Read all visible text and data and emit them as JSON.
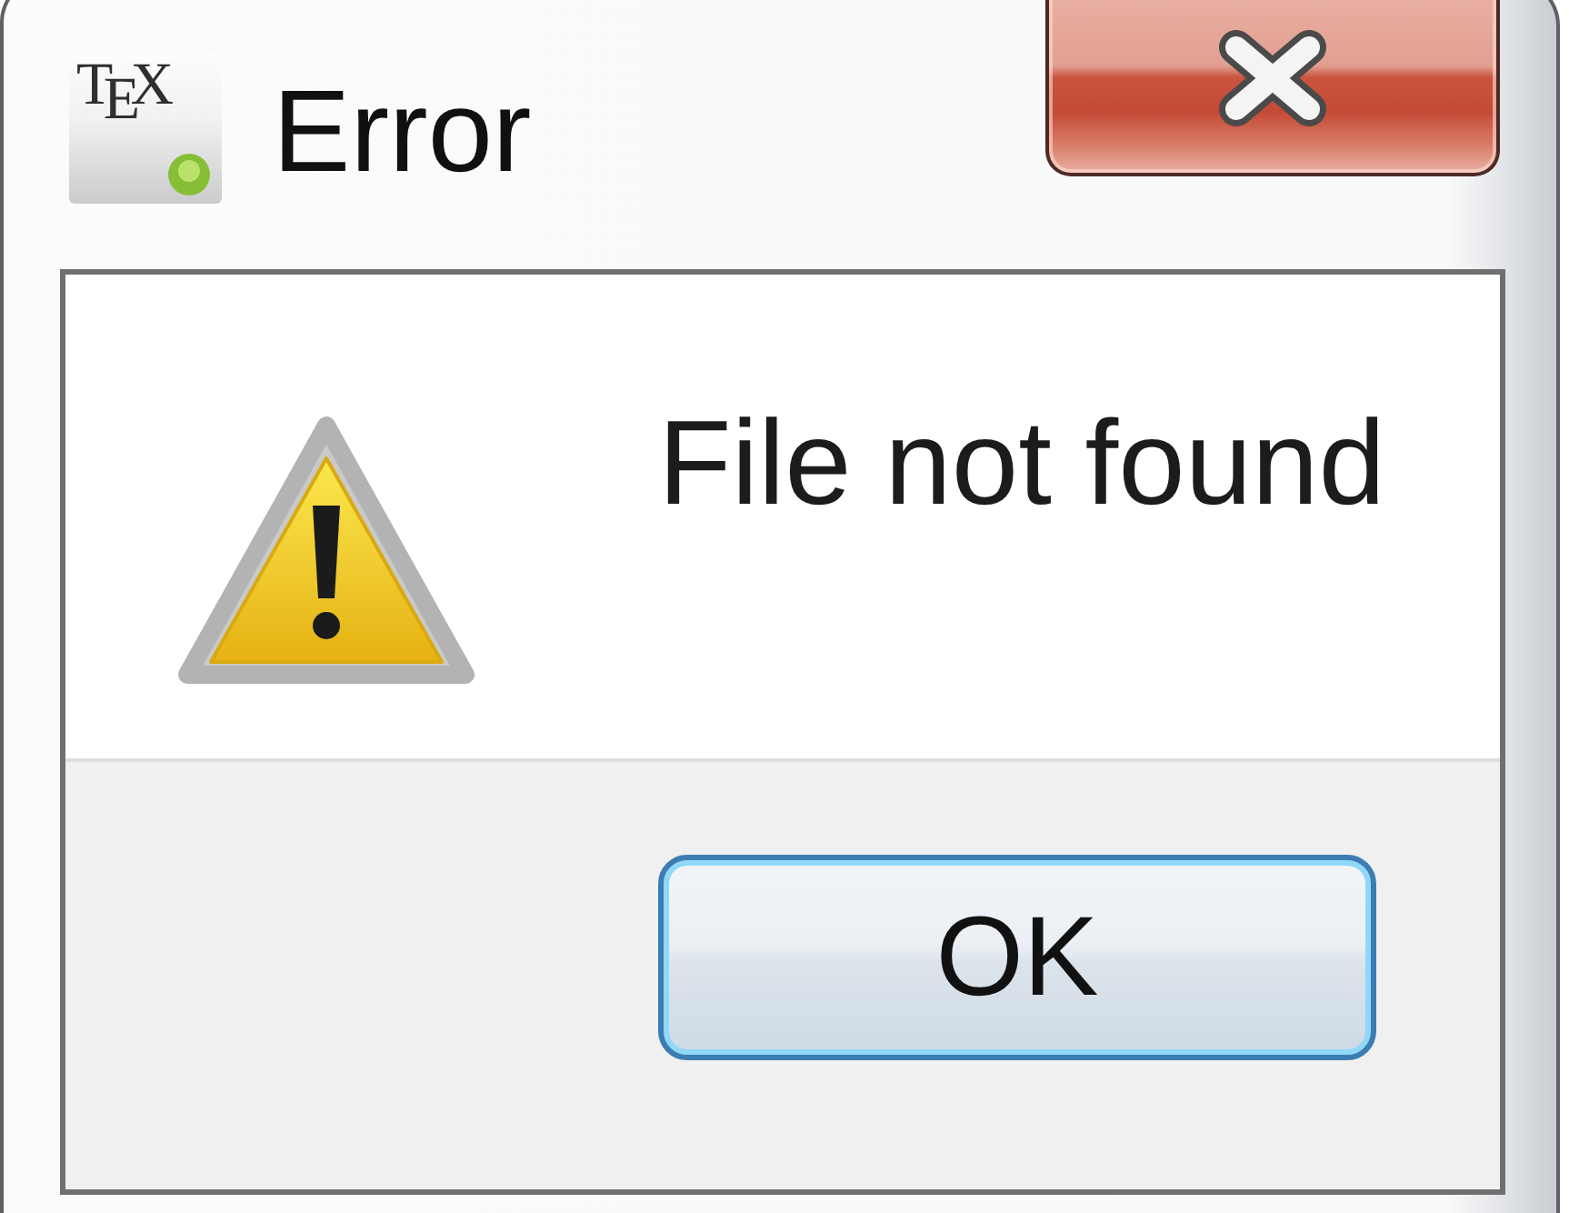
{
  "window": {
    "app_logo": "T$_{E}$X",
    "title": "Error"
  },
  "message": {
    "kind": "warning",
    "text": "File not found"
  },
  "buttons": [
    {
      "label": "OK",
      "focused": true
    }
  ]
}
